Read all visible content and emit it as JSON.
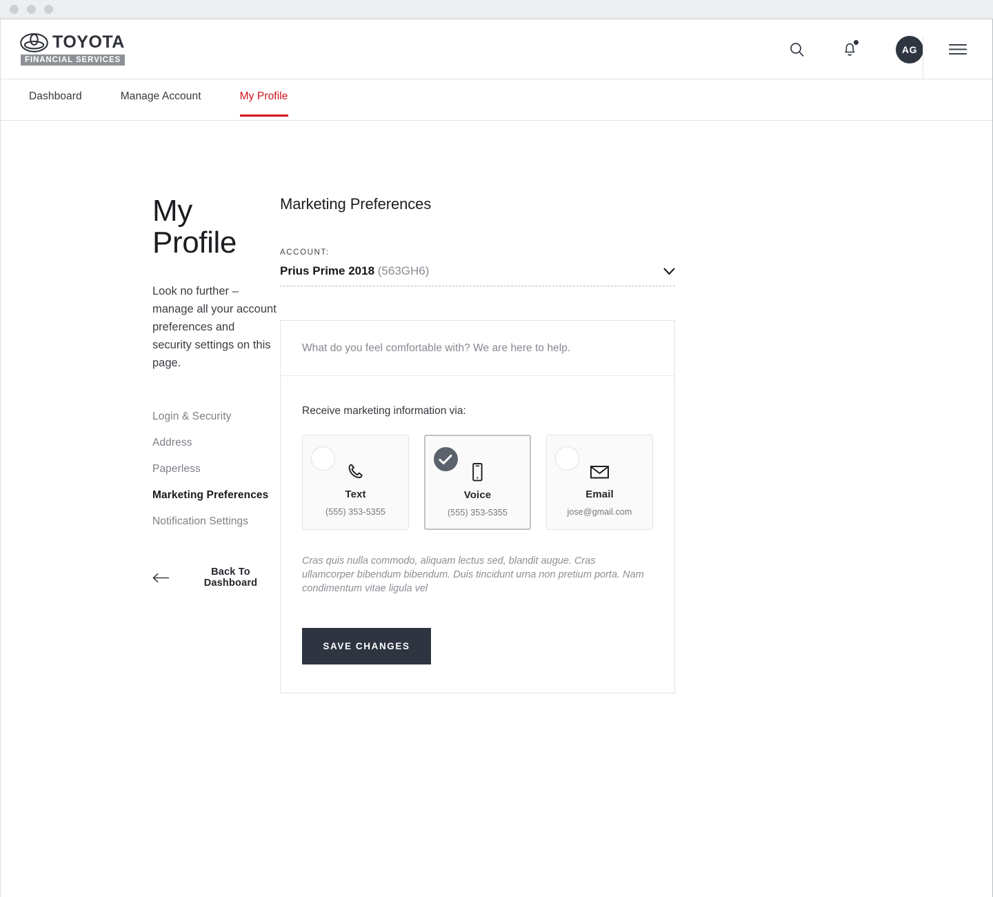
{
  "browser": {
    "traffic_lights": [
      "close",
      "minimize",
      "maximize"
    ]
  },
  "header": {
    "brand_name": "TOYOTA",
    "brand_sub": "FINANCIAL SERVICES",
    "search_icon": "search-icon",
    "notifications_icon": "bell-icon",
    "avatar_initials": "AG",
    "menu_icon": "hamburger-icon"
  },
  "tabs": [
    {
      "label": "Dashboard",
      "active": false
    },
    {
      "label": "Manage Account",
      "active": false
    },
    {
      "label": "My Profile",
      "active": true
    }
  ],
  "left": {
    "title": "My Profile",
    "description": "Look no further – manage all your account preferences and security settings on this page.",
    "nav": [
      {
        "label": "Login & Security",
        "current": false
      },
      {
        "label": "Address",
        "current": false
      },
      {
        "label": "Paperless",
        "current": false
      },
      {
        "label": "Marketing Preferences",
        "current": true
      },
      {
        "label": "Notification Settings",
        "current": false
      }
    ],
    "back_label": "Back To Dashboard",
    "back_icon": "arrow-left-icon"
  },
  "main": {
    "section_title": "Marketing Preferences",
    "account_label": "ACCOUNT:",
    "account_name": "Prius Prime 2018",
    "account_number": "(563GH6)",
    "account_chevron_icon": "chevron-down-icon",
    "card_intro": "What do you feel comfortable with?  We are here to help.",
    "body_label": "Receive marketing information via:",
    "options": [
      {
        "name": "Text",
        "value": "(555) 353-5355",
        "icon": "phone-icon",
        "selected": false
      },
      {
        "name": "Voice",
        "value": "(555) 353-5355",
        "icon": "mobile-icon",
        "selected": true
      },
      {
        "name": "Email",
        "value": "jose@gmail.com",
        "icon": "envelope-icon",
        "selected": false
      }
    ],
    "disclaimer": "Cras quis nulla commodo, aliquam lectus sed, blandit augue. Cras ullamcorper bibendum bibendum. Duis tincidunt urna non pretium porta. Nam condimentum vitae ligula vel",
    "save_label": "SAVE CHANGES"
  },
  "colors": {
    "accent_red": "#d1111b",
    "dark": "#2e3440",
    "muted": "#84888e"
  }
}
